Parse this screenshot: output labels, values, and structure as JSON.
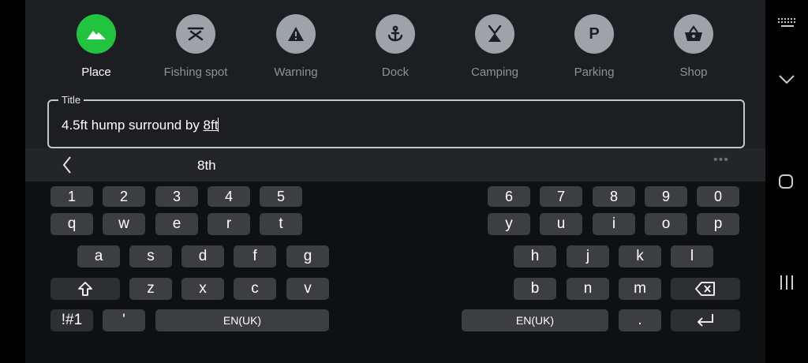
{
  "categories": [
    {
      "label": "Place",
      "icon": "mountain-icon",
      "active": true
    },
    {
      "label": "Fishing spot",
      "icon": "fishing-icon",
      "active": false
    },
    {
      "label": "Warning",
      "icon": "warning-icon",
      "active": false
    },
    {
      "label": "Dock",
      "icon": "anchor-icon",
      "active": false
    },
    {
      "label": "Camping",
      "icon": "tent-icon",
      "active": false
    },
    {
      "label": "Parking",
      "icon": "parking-icon",
      "active": false,
      "glyph": "P"
    },
    {
      "label": "Shop",
      "icon": "basket-icon",
      "active": false
    }
  ],
  "title_field": {
    "label": "Title",
    "value_plain": "4.5ft hump surround by ",
    "value_underlined": "8ft"
  },
  "keyboard": {
    "suggestion": "8th",
    "more": "•••",
    "left": {
      "row_num": [
        "1",
        "2",
        "3",
        "4",
        "5"
      ],
      "row1": [
        "q",
        "w",
        "e",
        "r",
        "t"
      ],
      "row2": [
        "a",
        "s",
        "d",
        "f",
        "g"
      ],
      "row3": [
        "z",
        "x",
        "c",
        "v"
      ],
      "symbols": "!#1",
      "apostrophe": "'",
      "space": "EN(UK)"
    },
    "right": {
      "row_num": [
        "6",
        "7",
        "8",
        "9",
        "0"
      ],
      "row1": [
        "y",
        "u",
        "i",
        "o",
        "p"
      ],
      "row2": [
        "h",
        "j",
        "k",
        "l"
      ],
      "row3": [
        "b",
        "n",
        "m"
      ],
      "space": "EN(UK)",
      "period": "."
    }
  },
  "colors": {
    "accent": "#22c33f",
    "panel": "#1c1e21",
    "key": "#3c3e42",
    "keyboard_bg": "#0f1012"
  }
}
